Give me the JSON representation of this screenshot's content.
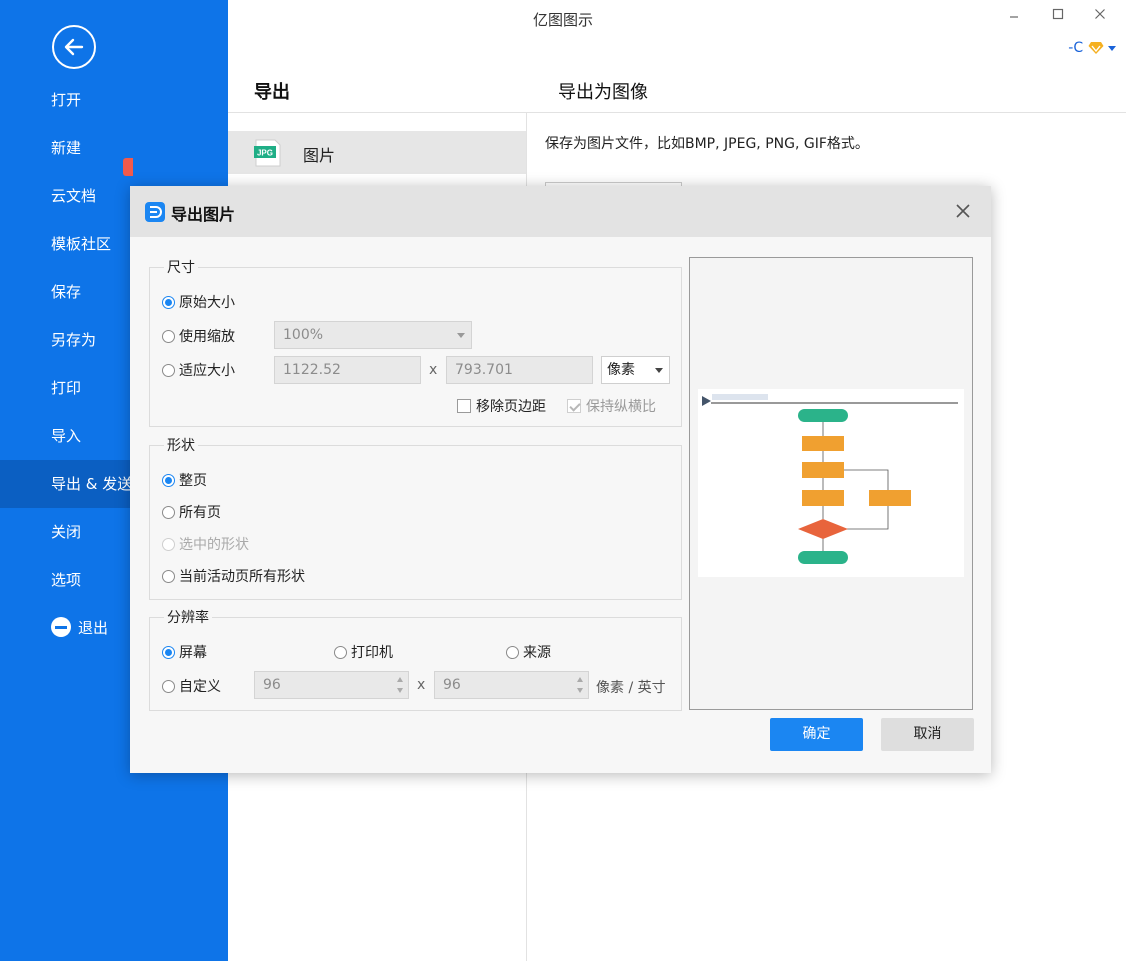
{
  "app": {
    "title": "亿图图示",
    "user_label": "-C"
  },
  "sidebar": {
    "items": [
      {
        "label": "打开"
      },
      {
        "label": "新建"
      },
      {
        "label": "云文档"
      },
      {
        "label": "模板社区"
      },
      {
        "label": "保存"
      },
      {
        "label": "另存为"
      },
      {
        "label": "打印"
      },
      {
        "label": "导入"
      },
      {
        "label": "导出 & 发送"
      },
      {
        "label": "关闭"
      },
      {
        "label": "选项"
      }
    ],
    "exit_label": "退出",
    "active_index": 8
  },
  "export_panel": {
    "title": "导出",
    "list": [
      {
        "label": "图片",
        "icon": "JPG"
      }
    ],
    "detail_title": "导出为图像",
    "detail_desc": "保存为图片文件，比如BMP, JPEG, PNG, GIF格式。"
  },
  "dialog": {
    "title": "导出图片",
    "size": {
      "title": "尺寸",
      "opt_original": "原始大小",
      "opt_scale": "使用缩放",
      "scale_value": "100%",
      "opt_fit": "适应大小",
      "width": "1122.52",
      "height": "793.701",
      "times": "x",
      "unit": "像素",
      "remove_margin": "移除页边距",
      "keep_ratio": "保持纵横比"
    },
    "shape": {
      "title": "形状",
      "opt_page": "整页",
      "opt_all_pages": "所有页",
      "opt_selected": "选中的形状",
      "opt_current_all": "当前活动页所有形状"
    },
    "resolution": {
      "title": "分辨率",
      "opt_screen": "屏幕",
      "opt_printer": "打印机",
      "opt_source": "来源",
      "opt_custom": "自定义",
      "dpi_x": "96",
      "dpi_y": "96",
      "times": "x",
      "unit": "像素 / 英寸"
    },
    "ok_label": "确定",
    "cancel_label": "取消"
  },
  "colors": {
    "sidebar": "#0e74e8",
    "accent": "#1b86f2",
    "node_green": "#2bb38a",
    "node_orange": "#f0a030",
    "node_red": "#e8643c"
  }
}
